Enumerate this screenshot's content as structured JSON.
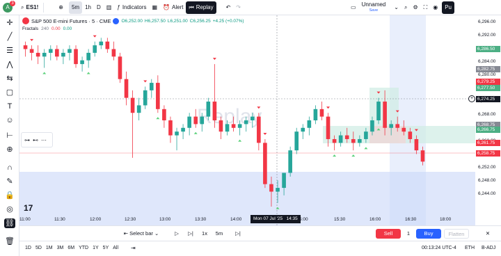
{
  "top": {
    "avatar_letter": "A",
    "avatar_badge": "3",
    "symbol": "ES1!",
    "intervals": [
      "5m",
      "1h",
      "D"
    ],
    "indicators_label": "Indicators",
    "alert_label": "Alert",
    "replay_label": "Replay",
    "layout_name": "Unnamed",
    "layout_status": "Save",
    "publish_label": "Pu"
  },
  "legend": {
    "title": "S&P 500 E-mini Futures · 5 · CME",
    "open": "O6,252.00",
    "high": "H6,257.50",
    "low": "L6,251.00",
    "close": "C6,256.25",
    "change": "+4.25 (+0.07%)",
    "indicator_name": "Fractals",
    "indicator_param": "240",
    "indicator_v1": "0.00",
    "indicator_v2": "0.00"
  },
  "price_axis": {
    "labels": [
      "6,296.00",
      "6,292.00",
      "6,288.00",
      "6,284.00",
      "6,280.00",
      "6,276.00",
      "6,272.00",
      "6,268.00",
      "6,264.00",
      "6,260.00",
      "6,256.00",
      "6,252.00",
      "6,248.00",
      "6,244.00"
    ],
    "badges": [
      {
        "text": "6,286.50",
        "color": "#4caf84"
      },
      {
        "text": "6,282.75",
        "color": "#868993"
      },
      {
        "text": "6,279.25",
        "color": "#f23645"
      },
      {
        "text": "6,277.50",
        "color": "#4caf84"
      },
      {
        "text": "6,274.25",
        "color": "#131722"
      },
      {
        "text": "6,268.75",
        "color": "#868993"
      },
      {
        "text": "6,266.75",
        "color": "#4caf84"
      },
      {
        "text": "6,261.75",
        "color": "#f23645"
      },
      {
        "text": "6,258.75",
        "color": "#f23645"
      }
    ]
  },
  "time_axis": {
    "labels": [
      "11:00",
      "11:30",
      "12:00",
      "12:30",
      "13:00",
      "13:30",
      "14:00",
      "5:00",
      "15:30",
      "16:00",
      "16:30",
      "18:00"
    ],
    "cursor": "Mon 07 Jul '25",
    "cursor_time": "14:35"
  },
  "watermark": "Replay",
  "replay_controls": {
    "select_bar": "Select bar",
    "speed": "1x",
    "step": "5m",
    "sell": "Sell",
    "qty": "1",
    "buy": "Buy",
    "flatten": "Flatten"
  },
  "footer": {
    "ranges": [
      "1D",
      "5D",
      "1M",
      "3M",
      "6M",
      "YTD",
      "1Y",
      "5Y",
      "All"
    ],
    "clock": "00:13:24 UTC-4",
    "session": "ETH",
    "adj": "B-ADJ"
  },
  "colors": {
    "up": "#26a69a",
    "down": "#f23645",
    "select": "#b3c7f7"
  },
  "chart_data": {
    "type": "candlestick",
    "y_range": [
      6242,
      6298
    ],
    "candles": [
      [
        6290,
        6291,
        6287,
        6289
      ],
      [
        6289,
        6290,
        6286,
        6288
      ],
      [
        6288,
        6290,
        6285,
        6287
      ],
      [
        6287,
        6289,
        6284,
        6288
      ],
      [
        6288,
        6290,
        6286,
        6289
      ],
      [
        6289,
        6290,
        6286,
        6287
      ],
      [
        6287,
        6289,
        6285,
        6288
      ],
      [
        6288,
        6290,
        6286,
        6289
      ],
      [
        6289,
        6290,
        6284,
        6285
      ],
      [
        6285,
        6287,
        6283,
        6286
      ],
      [
        6286,
        6289,
        6284,
        6288
      ],
      [
        6288,
        6291,
        6287,
        6290
      ],
      [
        6290,
        6292,
        6289,
        6291
      ],
      [
        6291,
        6292,
        6288,
        6289
      ],
      [
        6289,
        6291,
        6286,
        6287
      ],
      [
        6287,
        6288,
        6280,
        6281
      ],
      [
        6281,
        6283,
        6274,
        6276
      ],
      [
        6276,
        6278,
        6260,
        6272
      ],
      [
        6272,
        6276,
        6270,
        6274
      ],
      [
        6274,
        6279,
        6273,
        6278
      ],
      [
        6278,
        6281,
        6276,
        6280
      ],
      [
        6280,
        6282,
        6272,
        6273
      ],
      [
        6273,
        6274,
        6268,
        6270
      ],
      [
        6270,
        6271,
        6264,
        6266
      ],
      [
        6266,
        6268,
        6262,
        6267
      ],
      [
        6267,
        6269,
        6265,
        6268
      ],
      [
        6268,
        6272,
        6266,
        6271
      ],
      [
        6271,
        6273,
        6268,
        6269
      ],
      [
        6269,
        6272,
        6267,
        6271
      ],
      [
        6271,
        6276,
        6270,
        6275
      ],
      [
        6275,
        6285,
        6268,
        6270
      ],
      [
        6270,
        6271,
        6265,
        6267
      ],
      [
        6267,
        6270,
        6266,
        6269
      ],
      [
        6269,
        6271,
        6267,
        6268
      ],
      [
        6268,
        6270,
        6266,
        6269
      ],
      [
        6269,
        6271,
        6267,
        6270
      ],
      [
        6270,
        6272,
        6268,
        6271
      ],
      [
        6271,
        6272,
        6262,
        6264
      ],
      [
        6264,
        6265,
        6252,
        6253
      ],
      [
        6253,
        6255,
        6247,
        6251
      ],
      [
        6251,
        6254,
        6248,
        6252
      ],
      [
        6252,
        6256,
        6250,
        6256
      ],
      [
        6256,
        6263,
        6255,
        6262
      ],
      [
        6262,
        6268,
        6261,
        6267
      ],
      [
        6267,
        6269,
        6265,
        6268
      ],
      [
        6268,
        6271,
        6266,
        6270
      ],
      [
        6270,
        6274,
        6269,
        6273
      ],
      [
        6273,
        6275,
        6270,
        6271
      ],
      [
        6271,
        6272,
        6263,
        6265
      ],
      [
        6265,
        6266,
        6262,
        6264
      ],
      [
        6264,
        6267,
        6263,
        6266
      ],
      [
        6266,
        6268,
        6264,
        6265
      ],
      [
        6265,
        6267,
        6262,
        6264
      ],
      [
        6264,
        6266,
        6263,
        6265
      ],
      [
        6265,
        6268,
        6264,
        6267
      ],
      [
        6267,
        6271,
        6266,
        6270
      ],
      [
        6270,
        6276,
        6269,
        6275
      ],
      [
        6275,
        6278,
        6266,
        6268
      ],
      [
        6268,
        6270,
        6266,
        6269
      ],
      [
        6269,
        6271,
        6267,
        6268
      ],
      [
        6268,
        6270,
        6266,
        6267
      ],
      [
        6267,
        6268,
        6264,
        6265
      ],
      [
        6265,
        6266,
        6261,
        6262
      ],
      [
        6262,
        6263,
        6258,
        6259
      ]
    ],
    "fractal_up_index": [
      1,
      11,
      19,
      30,
      37,
      38,
      48,
      56,
      59,
      62
    ],
    "fractal_down_index": [
      3,
      10,
      21,
      27,
      34,
      40,
      49,
      52,
      54,
      56
    ]
  }
}
